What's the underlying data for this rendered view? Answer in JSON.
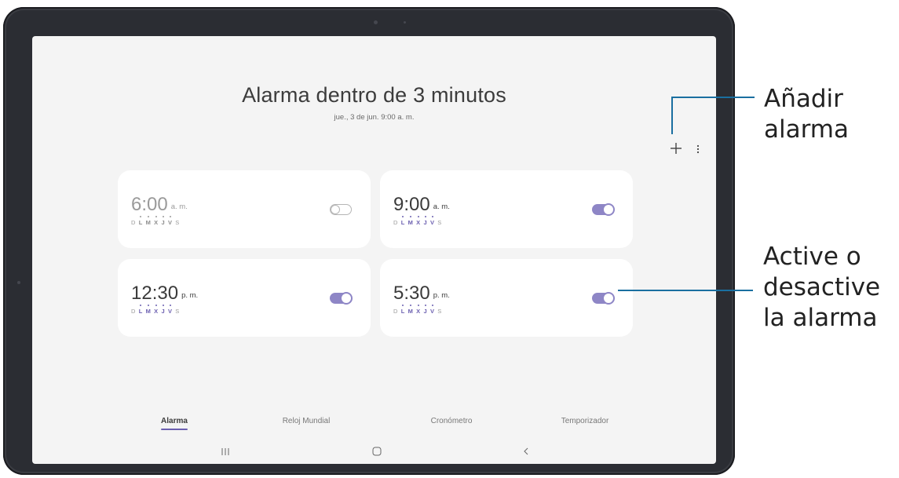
{
  "header": {
    "title": "Alarma dentro de 3 minutos",
    "subtitle": "jue., 3 de jun. 9:00 a. m."
  },
  "toolbar": {
    "add_icon": "plus-icon",
    "more_icon": "more-vert-icon"
  },
  "alarms": [
    {
      "time": "6:00",
      "suffix": "a. m.",
      "enabled": false,
      "days": [
        "D",
        "L",
        "M",
        "X",
        "J",
        "V",
        "S"
      ],
      "active_days": [
        "L",
        "M",
        "X",
        "J",
        "V"
      ]
    },
    {
      "time": "9:00",
      "suffix": "a. m.",
      "enabled": true,
      "days": [
        "D",
        "L",
        "M",
        "X",
        "J",
        "V",
        "S"
      ],
      "active_days": [
        "L",
        "M",
        "X",
        "J",
        "V"
      ]
    },
    {
      "time": "12:30",
      "suffix": "p. m.",
      "enabled": true,
      "days": [
        "D",
        "L",
        "M",
        "X",
        "J",
        "V",
        "S"
      ],
      "active_days": [
        "L",
        "M",
        "X",
        "J",
        "V"
      ]
    },
    {
      "time": "5:30",
      "suffix": "p. m.",
      "enabled": true,
      "days": [
        "D",
        "L",
        "M",
        "X",
        "J",
        "V",
        "S"
      ],
      "active_days": [
        "L",
        "M",
        "X",
        "J",
        "V"
      ]
    }
  ],
  "tabs": [
    {
      "label": "Alarma",
      "active": true
    },
    {
      "label": "Reloj Mundial",
      "active": false
    },
    {
      "label": "Cronómetro",
      "active": false
    },
    {
      "label": "Temporizador",
      "active": false
    }
  ],
  "navbar": {
    "recents_icon": "recents-icon",
    "home_icon": "home-icon",
    "back_icon": "back-icon"
  },
  "callouts": {
    "add_alarm": [
      "Añadir",
      "alarma"
    ],
    "toggle_alarm": [
      "Active o",
      "desactive",
      "la alarma"
    ]
  },
  "colors": {
    "accent": "#6b5fb0",
    "toggle_on": "#8e86c6",
    "callout_line": "#1a6fa0"
  }
}
